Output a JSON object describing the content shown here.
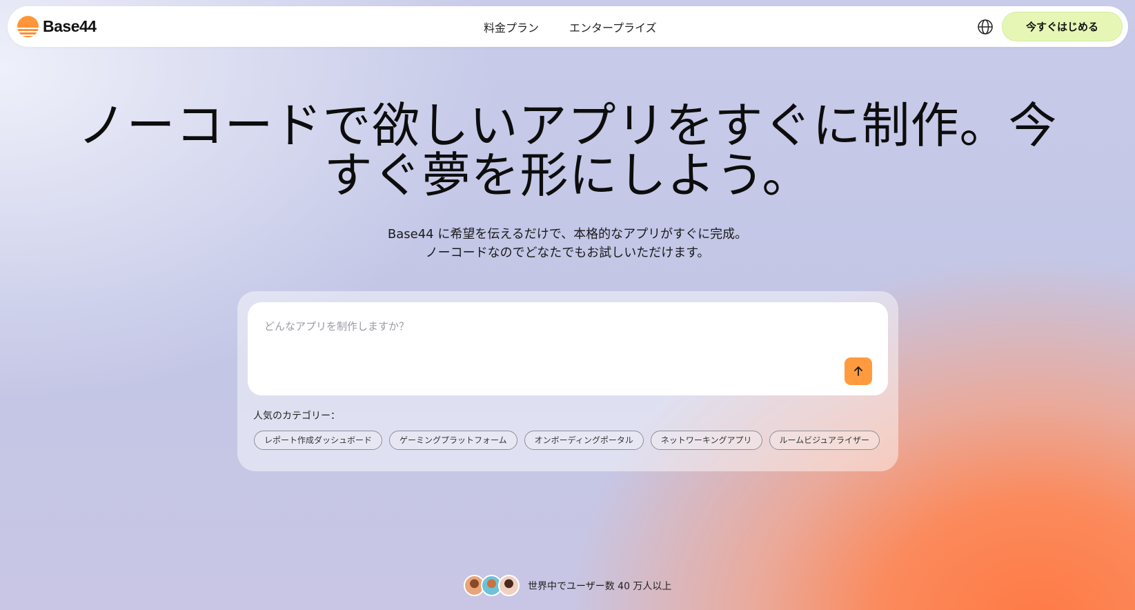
{
  "brand": {
    "name": "Base44",
    "logo_color": "#ff8a2e"
  },
  "nav": {
    "links": [
      "料金プラン",
      "エンタープライズ"
    ],
    "language_icon": "globe-icon",
    "cta_label": "今すぐはじめる",
    "cta_color": "#e6f7b5"
  },
  "hero": {
    "title_line1": "ノーコードで欲しいアプリをすぐに制作。今",
    "title_line2": "すぐ夢を形にしよう。",
    "subtitle_line1": "Base44 に希望を伝えるだけで、本格的なアプリがすぐに完成。",
    "subtitle_line2": "ノーコードなのでどなたでもお試しいただけます。"
  },
  "prompt": {
    "placeholder": "どんなアプリを制作しますか？",
    "value": "",
    "send_icon": "arrow-up-icon",
    "send_color": "#ff9a3f"
  },
  "categories": {
    "label": "人気のカテゴリー：",
    "items": [
      "レポート作成ダッシュボード",
      "ゲーミングプラットフォーム",
      "オンボーディングポータル",
      "ネットワーキングアプリ",
      "ルームビジュアライザー"
    ]
  },
  "social_proof": {
    "text": "世界中でユーザー数 40 万人以上",
    "avatar_count": 3
  }
}
